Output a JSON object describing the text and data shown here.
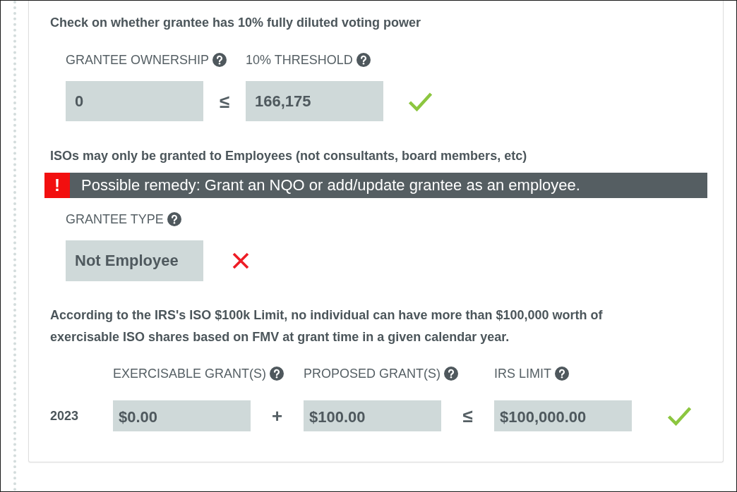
{
  "checks": [
    {
      "kind": "comparison",
      "heading": "Check on whether grantee has 10% fully diluted voting power",
      "fields": [
        {
          "label": "GRANTEE OWNERSHIP",
          "value": "0"
        },
        {
          "label": "10% THRESHOLD",
          "value": "166,175"
        }
      ],
      "operators": [
        "≤"
      ],
      "passed": true
    },
    {
      "kind": "eligibility",
      "heading": "ISOs may only be granted to Employees (not consultants, board members, etc)",
      "alert": {
        "symbol": "!",
        "message": "Possible remedy: Grant an NQO or add/update grantee as an employee."
      },
      "fields": [
        {
          "label": "GRANTEE TYPE",
          "value": "Not Employee"
        }
      ],
      "passed": false
    },
    {
      "kind": "annual_limit",
      "heading": "According to the IRS's ISO $100k Limit, no individual can have more than $100,000 worth of exercisable ISO shares based on FMV at grant time in a given calendar year.",
      "row_label": "2023",
      "fields": [
        {
          "label": "EXERCISABLE GRANT(S)",
          "value": "$0.00"
        },
        {
          "label": "PROPOSED GRANT(S)",
          "value": "$100.00"
        },
        {
          "label": "IRS LIMIT",
          "value": "$100,000.00"
        }
      ],
      "operators": [
        "+",
        "≤"
      ],
      "passed": true
    }
  ]
}
